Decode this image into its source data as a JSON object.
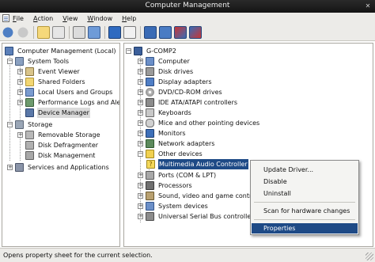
{
  "window": {
    "title": "Computer Management"
  },
  "menu": [
    {
      "label": "File",
      "key": "F",
      "rest": "ile"
    },
    {
      "label": "Action",
      "key": "A",
      "rest": "ction"
    },
    {
      "label": "View",
      "key": "V",
      "rest": "iew"
    },
    {
      "label": "Window",
      "key": "W",
      "rest": "indow"
    },
    {
      "label": "Help",
      "key": "H",
      "rest": "elp"
    }
  ],
  "left_tree": {
    "root": "Computer Management (Local)",
    "system_tools": "System Tools",
    "event_viewer": "Event Viewer",
    "shared_folders": "Shared Folders",
    "local_users": "Local Users and Groups",
    "perf_logs": "Performance Logs and Aler",
    "device_manager": "Device Manager",
    "storage": "Storage",
    "removable_storage": "Removable Storage",
    "disk_defrag": "Disk Defragmenter",
    "disk_mgmt": "Disk Management",
    "services": "Services and Applications"
  },
  "right_tree": {
    "root": "G-COMP2",
    "computer": "Computer",
    "disk_drives": "Disk drives",
    "display_adapters": "Display adapters",
    "dvd": "DVD/CD-ROM drives",
    "ide": "IDE ATA/ATAPI controllers",
    "keyboards": "Keyboards",
    "mice": "Mice and other pointing devices",
    "monitors": "Monitors",
    "network": "Network adapters",
    "other": "Other devices",
    "multimedia": "Multimedia Audio Controller",
    "ports": "Ports (COM & LPT)",
    "processors": "Processors",
    "sound": "Sound, video and game controllers",
    "system_devices": "System devices",
    "usb": "Universal Serial Bus controllers"
  },
  "context_menu": {
    "update_driver": "Update Driver...",
    "disable": "Disable",
    "uninstall": "Uninstall",
    "scan": "Scan for hardware changes",
    "properties": "Properties"
  },
  "status": {
    "text": "Opens property sheet for the current selection."
  },
  "colors": {
    "title_bar": "#1c1c1c",
    "selection": "#1e4a86",
    "chrome": "#ecebe8"
  }
}
